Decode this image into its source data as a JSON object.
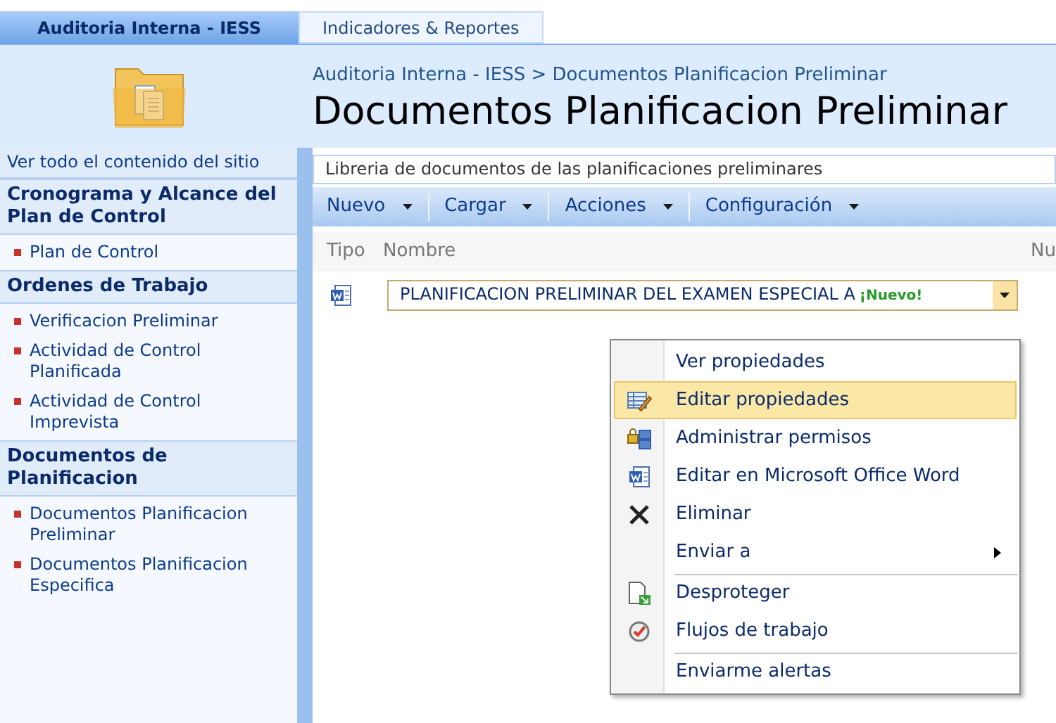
{
  "top_tabs": [
    {
      "label": "Auditoria Interna - IESS",
      "selected": true
    },
    {
      "label": "Indicadores & Reportes",
      "selected": false
    }
  ],
  "breadcrumb": "Auditoria Interna - IESS > Documentos Planificacion Preliminar",
  "page_title": "Documentos Planificacion Preliminar",
  "sidebar": {
    "view_all": "Ver todo el contenido del sitio",
    "sections": [
      {
        "heading": "Cronograma y Alcance del Plan de Control",
        "items": [
          "Plan de Control"
        ]
      },
      {
        "heading": "Ordenes de Trabajo",
        "items": [
          "Verificacion Preliminar",
          "Actividad de Control Planificada",
          "Actividad de Control Imprevista"
        ]
      },
      {
        "heading": "Documentos de Planificacion",
        "items": [
          "Documentos Planificacion Preliminar",
          "Documentos Planificacion Especifica"
        ]
      }
    ]
  },
  "description": "Libreria de documentos de las planificaciones preliminares",
  "toolbar": [
    "Nuevo",
    "Cargar",
    "Acciones",
    "Configuración"
  ],
  "columns": [
    "Tipo",
    "Nombre",
    "Nu"
  ],
  "rows": [
    {
      "name": "PLANIFICACION PRELIMINAR DEL EXAMEN ESPECIAL A",
      "new_badge": "¡Nuevo!",
      "selected": true
    }
  ],
  "context_menu": [
    {
      "label": "Ver propiedades",
      "kind": "plain",
      "selected": false,
      "divider_before": false
    },
    {
      "label": "Editar propiedades",
      "kind": "edit",
      "selected": true,
      "divider_before": false
    },
    {
      "label": "Administrar permisos",
      "kind": "permissions",
      "selected": false,
      "divider_before": false
    },
    {
      "label": "Editar en Microsoft Office Word",
      "kind": "word",
      "selected": false,
      "divider_before": false
    },
    {
      "label": "Eliminar",
      "kind": "delete",
      "selected": false,
      "divider_before": false
    },
    {
      "label": "Enviar a",
      "kind": "submenu",
      "selected": false,
      "divider_before": false
    },
    {
      "label": "Desproteger",
      "kind": "checkin",
      "selected": false,
      "divider_before": true
    },
    {
      "label": "Flujos de trabajo",
      "kind": "workflow",
      "selected": false,
      "divider_before": false
    },
    {
      "label": "Enviarme alertas",
      "kind": "plain",
      "selected": false,
      "divider_before": true
    }
  ]
}
